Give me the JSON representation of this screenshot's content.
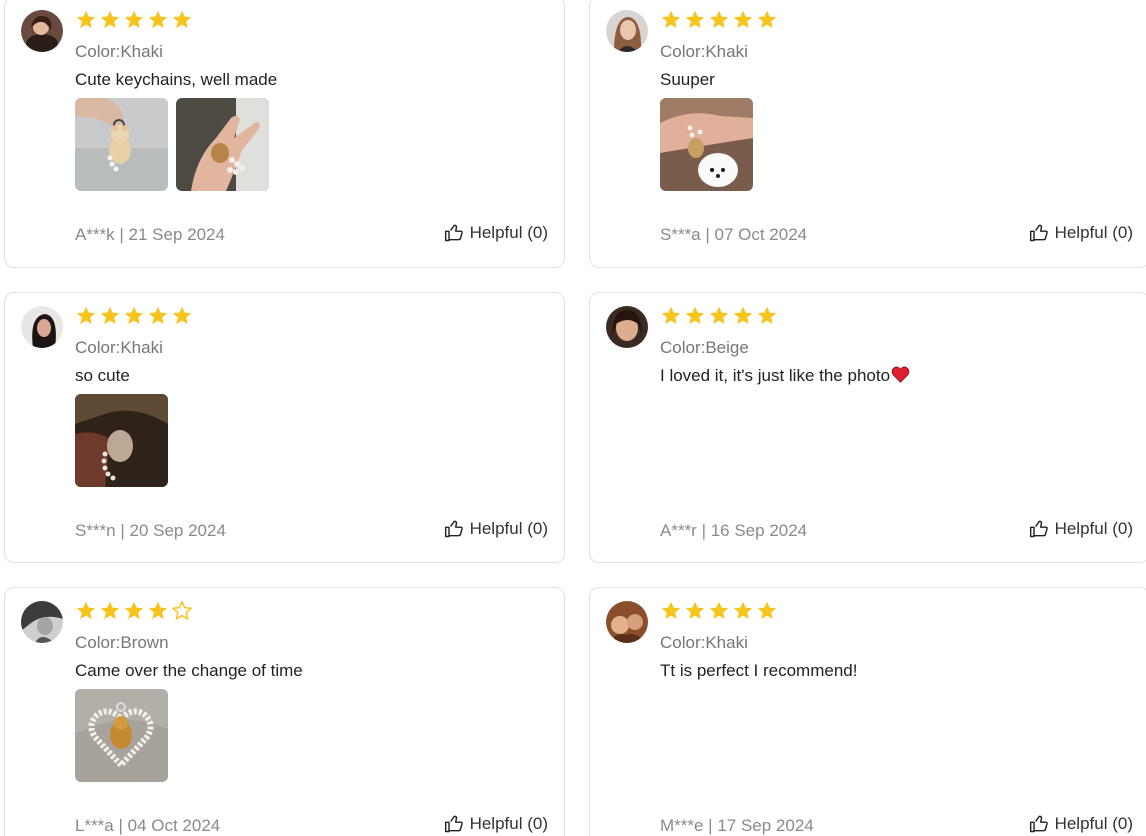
{
  "reviews": [
    {
      "rating": 5,
      "color_label": "Color:Khaki",
      "text": "Cute keychains, well made",
      "emoji": "",
      "photos": [
        "photo-bear-keychain-hand",
        "photo-pearl-keychain-palm"
      ],
      "author_date": "A***k | 21 Sep 2024",
      "helpful": "Helpful (0)"
    },
    {
      "rating": 5,
      "color_label": "Color:Khaki",
      "text": "Suuper",
      "emoji": "",
      "photos": [
        "photo-keychain-with-dog"
      ],
      "author_date": "S***a | 07 Oct 2024",
      "helpful": "Helpful (0)"
    },
    {
      "rating": 5,
      "color_label": "Color:Khaki",
      "text": "so cute",
      "emoji": "",
      "photos": [
        "photo-keychain-dark"
      ],
      "author_date": "S***n | 20 Sep 2024",
      "helpful": "Helpful (0)"
    },
    {
      "rating": 5,
      "color_label": "Color:Beige",
      "text": "I loved it, it's just like the photo",
      "emoji": "heart-emoji",
      "photos": [],
      "author_date": "A***r | 16 Sep 2024",
      "helpful": "Helpful (0)"
    },
    {
      "rating": 4,
      "color_label": "Color:Brown",
      "text": "Came over the change of time",
      "emoji": "",
      "photos": [
        "photo-heart-pearl-keychain"
      ],
      "author_date": "L***a | 04 Oct 2024",
      "helpful": "Helpful (0)"
    },
    {
      "rating": 5,
      "color_label": "Color:Khaki",
      "text": "Tt is perfect I recommend!",
      "emoji": "",
      "photos": [],
      "author_date": "M***e | 17 Sep 2024",
      "helpful": "Helpful (0)"
    }
  ],
  "colors": {
    "star": "#f7c31d",
    "card_border": "#e2e2e2",
    "meta_text": "#8a8a8a",
    "heart": "#e0202f"
  },
  "icons": {
    "star": "star-icon",
    "star_empty": "star-outline-icon",
    "helpful": "thumbs-up-icon",
    "heart": "heart-icon"
  }
}
